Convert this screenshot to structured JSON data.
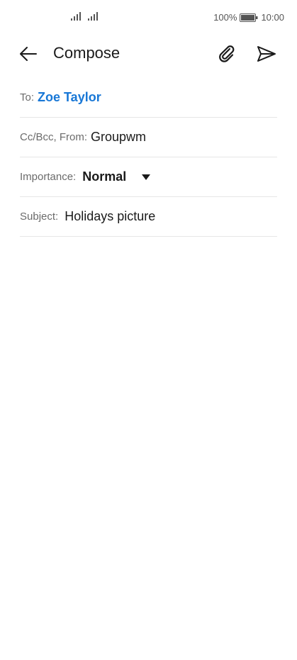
{
  "status_bar": {
    "battery_percent": "100%",
    "time": "10:00",
    "icons": [
      "signal-icon",
      "signal-icon",
      "battery-icon"
    ]
  },
  "app_bar": {
    "title": "Compose",
    "icons": [
      "back-arrow-icon",
      "paperclip-icon",
      "send-icon"
    ]
  },
  "form": {
    "to_label": "To:",
    "to_value": "Zoe Taylor",
    "ccbcc_label": "Cc/Bcc, From:",
    "from_value": "Groupwm",
    "importance_label": "Importance:",
    "importance_value": "Normal",
    "subject_label": "Subject:",
    "subject_value": "Holidays picture"
  },
  "colors": {
    "accent": "#1877d6",
    "text": "#1a1a1a",
    "label": "#6b6b6b",
    "divider": "#e6e6e6"
  }
}
